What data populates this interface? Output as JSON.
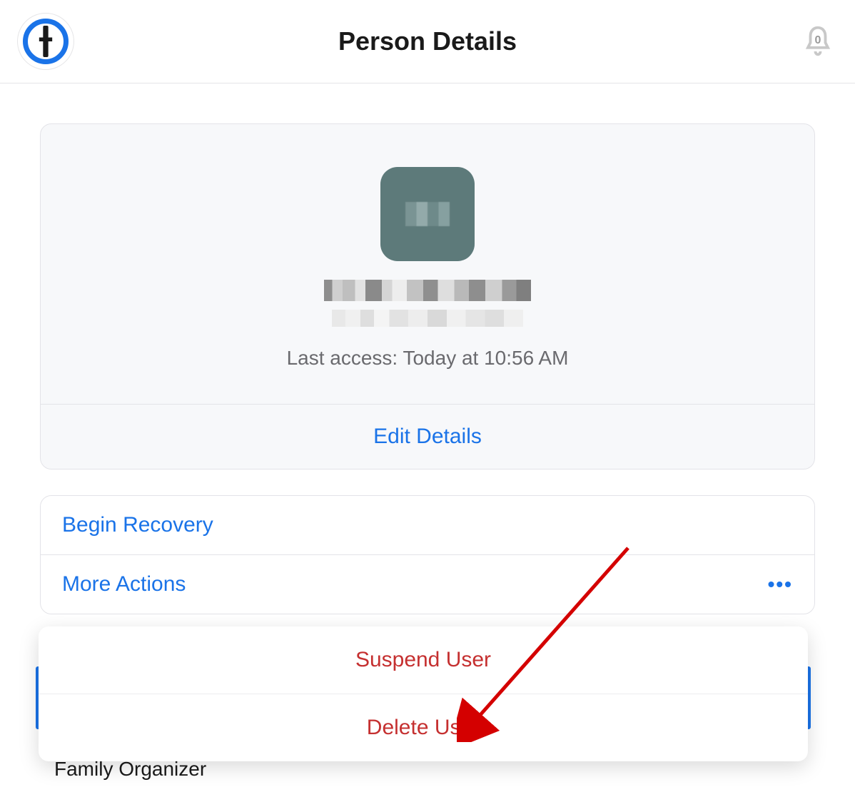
{
  "header": {
    "title": "Person Details",
    "notif_count": "0"
  },
  "profile": {
    "last_access": "Last access: Today at 10:56 AM",
    "edit_label": "Edit Details"
  },
  "actions": {
    "begin_recovery": "Begin Recovery",
    "more_actions": "More Actions"
  },
  "dropdown": {
    "suspend": "Suspend User",
    "delete": "Delete User"
  },
  "cutoff_text": "Family Organizer"
}
